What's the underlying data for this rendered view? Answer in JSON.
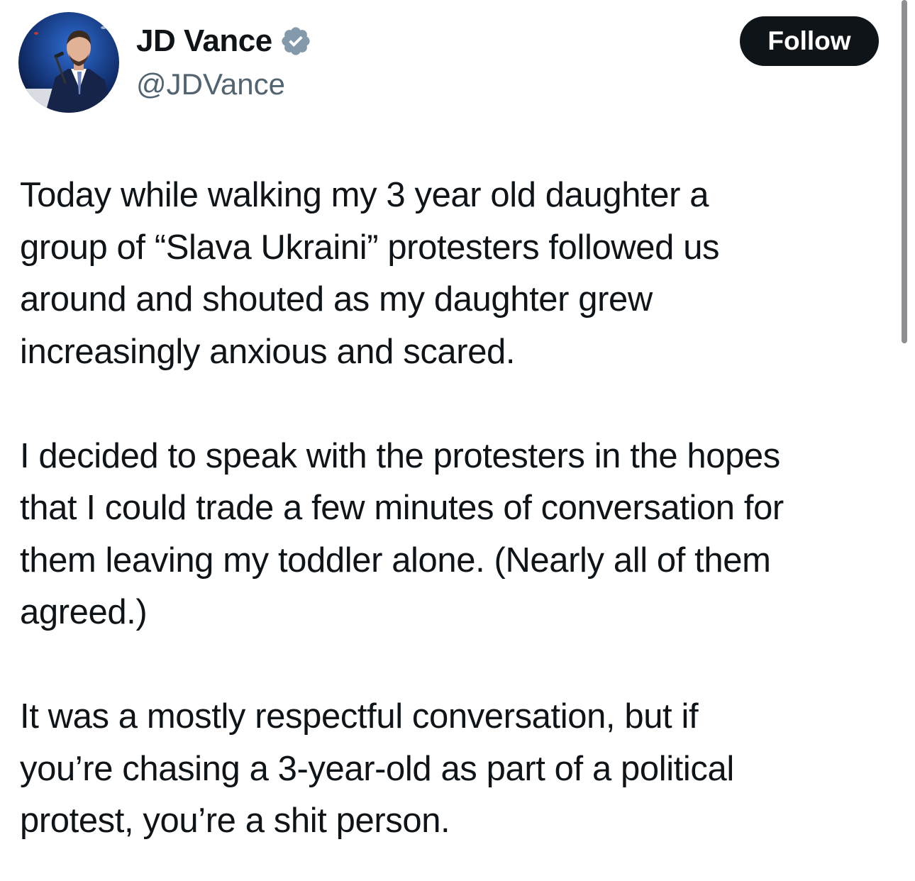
{
  "author": {
    "display_name": "JD Vance",
    "handle": "@JDVance",
    "verified_icon": "verified-badge-icon",
    "verified_color": "#829aab"
  },
  "follow_button": {
    "label": "Follow",
    "bg_color": "#0f1419",
    "text_color": "#ffffff"
  },
  "tweet": {
    "paragraphs": [
      "Today while walking my 3 year old daughter a\ngroup of “Slava Ukraini” protesters followed us\naround and shouted as my daughter grew\nincreasingly anxious and scared.",
      "I decided to speak with the protesters in the hopes\nthat I could trade a few minutes of conversation for\nthem leaving my toddler alone. (Nearly all of them\nagreed.)",
      "It was a mostly respectful conversation,  but if\nyou’re chasing a 3-year-old as part of a political\nprotest, you’re a shit person."
    ]
  }
}
